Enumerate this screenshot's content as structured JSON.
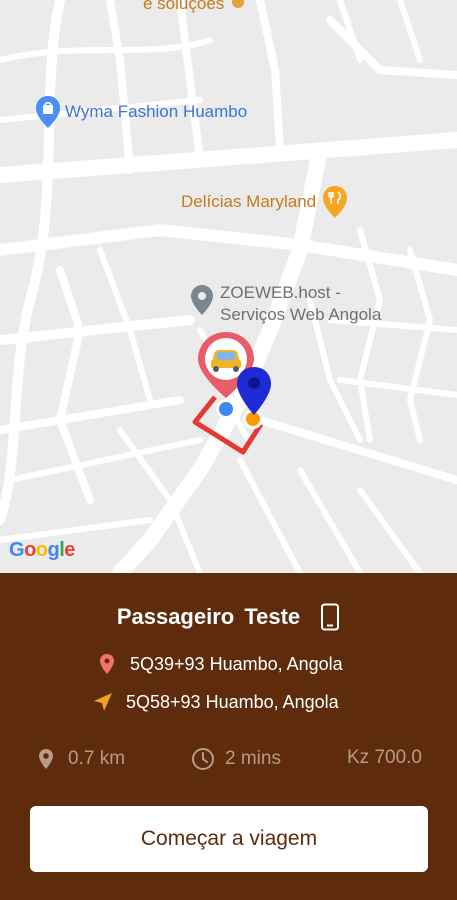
{
  "map": {
    "pois": {
      "top": "e soluções",
      "wyma": "Wyma Fashion Huambo",
      "delicias": "Delícias Maryland",
      "zoeweb_line1": "ZOEWEB.host -",
      "zoeweb_line2": "Serviços Web Angola"
    },
    "google_logo": {
      "G": "G",
      "o1": "o",
      "o2": "o",
      "g": "g",
      "l": "l",
      "e": "e"
    }
  },
  "trip": {
    "passenger_name": "Passageiro Teste",
    "origin": "5Q39+93 Huambo, Angola",
    "destination": "5Q58+93 Huambo, Angola",
    "distance": "0.7 km",
    "duration": "2 mins",
    "fare": "Kz 700.0",
    "start_button": "Começar a viagem"
  },
  "colors": {
    "panel_bg": "#5e2c0d",
    "map_bg": "#ebebeb",
    "route": "#e53935",
    "destination_pin": "#1f2bd6",
    "origin_dot": "#ff9800",
    "poi_orange": "#c77a1d",
    "poi_blue": "#3f74d8"
  },
  "icons": {
    "phone": "phone-icon",
    "origin": "location-pin-icon",
    "destination": "navigation-arrow-icon",
    "distance": "map-pin-icon",
    "duration": "clock-icon",
    "car_marker": "car-marker-icon",
    "dest_marker": "destination-marker-icon",
    "my_location": "my-location-dot-icon"
  }
}
